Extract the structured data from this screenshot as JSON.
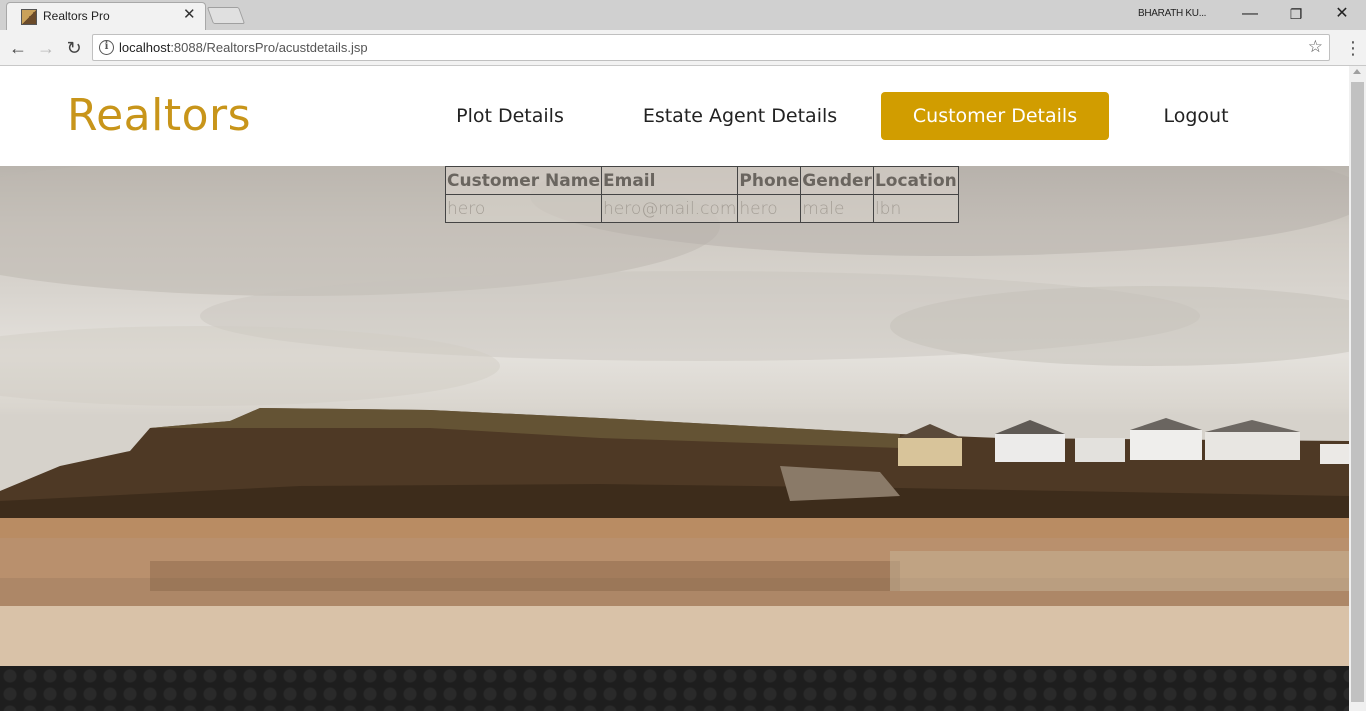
{
  "browser": {
    "tab_title": "Realtors Pro",
    "user_label": "BHARATH KU...",
    "url_host": "localhost",
    "url_rest": ":8088/RealtorsPro/acustdetails.jsp"
  },
  "site": {
    "logo": "Realtors",
    "nav": [
      {
        "label": "Plot Details",
        "active": false
      },
      {
        "label": "Estate Agent Details",
        "active": false
      },
      {
        "label": "Customer Details",
        "active": true
      },
      {
        "label": "Logout",
        "active": false
      }
    ]
  },
  "table": {
    "headers": [
      "Customer Name",
      "Email",
      "Phone",
      "Gender",
      "Location"
    ],
    "rows": [
      [
        "hero",
        "hero@mail.com",
        "hero",
        "male",
        "lbn"
      ]
    ]
  },
  "colors": {
    "brand": "#c8951a",
    "active_nav_bg": "#d19d00",
    "footer_bg": "#1e1e1e"
  }
}
